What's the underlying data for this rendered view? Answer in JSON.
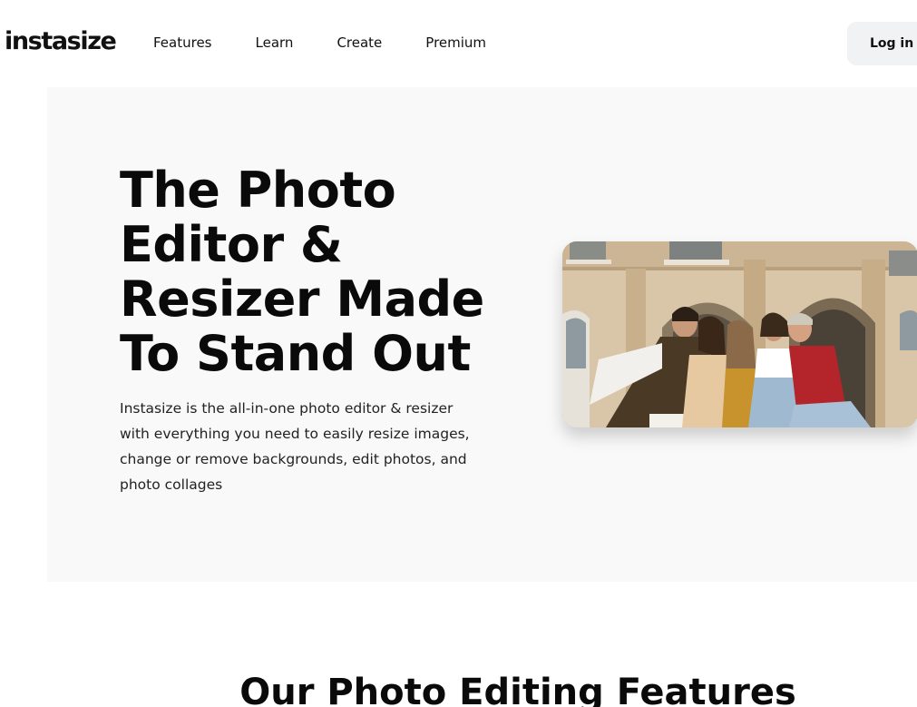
{
  "brand": {
    "logo": "instasize"
  },
  "nav": {
    "items": [
      {
        "label": "Features"
      },
      {
        "label": "Learn"
      },
      {
        "label": "Create"
      },
      {
        "label": "Premium"
      }
    ],
    "login_label": "Log in"
  },
  "hero": {
    "title": "The Photo Editor & Resizer Made To Stand Out",
    "description": "Instasize is the all-in-one photo editor & resizer with everything you need to easily resize images, change or remove backgrounds, edit photos, and photo collages"
  },
  "features": {
    "title": "Our Photo Editing Features"
  }
}
